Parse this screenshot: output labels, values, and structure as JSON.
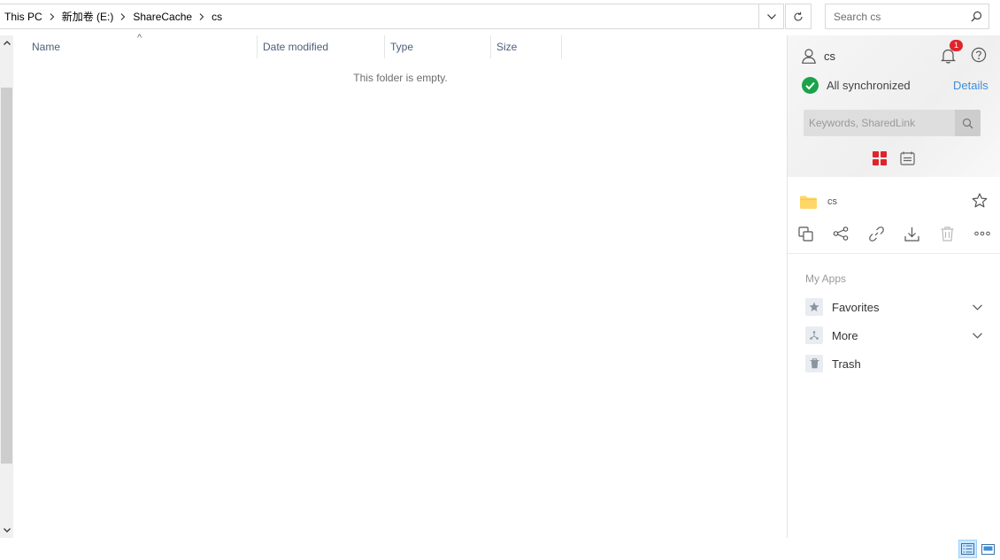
{
  "address_bar": {
    "crumbs": [
      "This PC",
      "新加卷 (E:)",
      "ShareCache",
      "cs"
    ]
  },
  "search": {
    "placeholder": "Search cs"
  },
  "file_list": {
    "columns": [
      "Name",
      "Date modified",
      "Type",
      "Size"
    ],
    "sort_column": "Name",
    "empty_text": "This folder is empty."
  },
  "panel": {
    "user_name": "cs",
    "notification_count": "1",
    "sync_status": "All synchronized",
    "details_label": "Details",
    "search_placeholder": "Keywords, SharedLink",
    "current_folder": "cs",
    "apps_title": "My Apps",
    "apps": [
      {
        "label": "Favorites",
        "icon": "star-icon",
        "expandable": true
      },
      {
        "label": "More",
        "icon": "apps-more-icon",
        "expandable": true
      },
      {
        "label": "Trash",
        "icon": "trash-icon",
        "expandable": false
      }
    ]
  },
  "colors": {
    "accent_blue": "#3d8fd9",
    "sync_green": "#1aa34a",
    "badge_red": "#e0242b",
    "grid_view_red": "#e0242b",
    "folder_yellow": "#ffd766"
  }
}
